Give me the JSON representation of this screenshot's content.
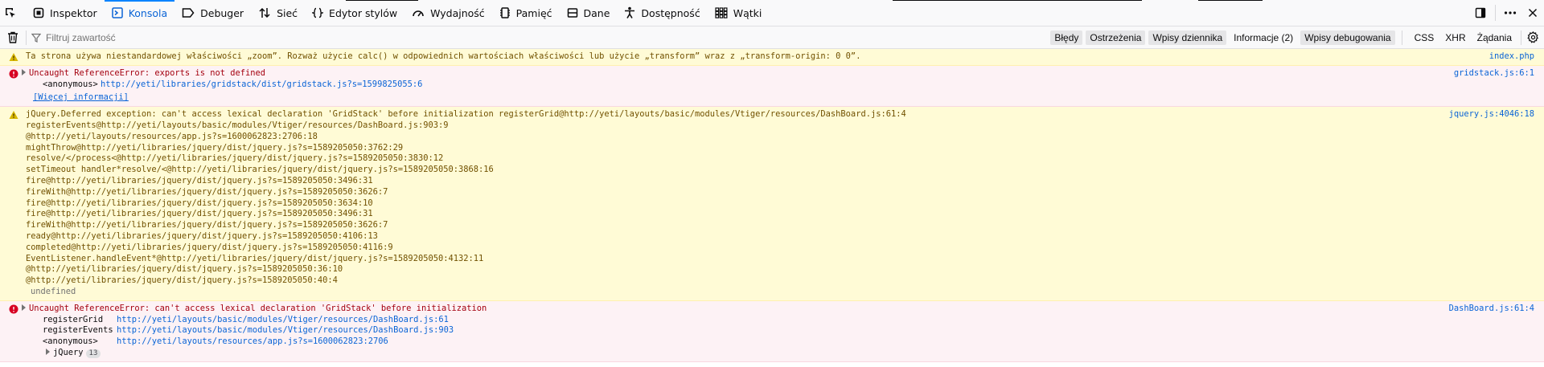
{
  "toolbar": {
    "tabs": [
      {
        "label": "Inspektor",
        "icon": "inspector-icon"
      },
      {
        "label": "Konsola",
        "icon": "console-icon",
        "selected": true
      },
      {
        "label": "Debuger",
        "icon": "debugger-icon"
      },
      {
        "label": "Sieć",
        "icon": "network-icon"
      },
      {
        "label": "Edytor stylów",
        "icon": "style-editor-icon"
      },
      {
        "label": "Wydajność",
        "icon": "performance-icon"
      },
      {
        "label": "Pamięć",
        "icon": "memory-icon"
      },
      {
        "label": "Dane",
        "icon": "storage-icon"
      },
      {
        "label": "Dostępność",
        "icon": "accessibility-icon"
      },
      {
        "label": "Wątki",
        "icon": "threads-icon"
      }
    ],
    "right_icons": [
      "dock-icon",
      "more-icon",
      "close-icon"
    ]
  },
  "filterbar": {
    "placeholder": "Filtruj zawartość",
    "levels": [
      {
        "label": "Błędy",
        "on": true
      },
      {
        "label": "Ostrzeżenia",
        "on": true
      },
      {
        "label": "Wpisy dziennika",
        "on": true
      },
      {
        "label": "Informacje (2)",
        "on": false
      },
      {
        "label": "Wpisy debugowania",
        "on": true
      }
    ],
    "extras": [
      "CSS",
      "XHR",
      "Żądania"
    ]
  },
  "messages": {
    "m1": {
      "text": "Ta strona używa niestandardowej właściwości „zoom”. Rozważ użycie calc() w odpowiednich wartościach właściwości lub użycie „transform” wraz z „transform-origin: 0 0”.",
      "location": "index.php"
    },
    "m2": {
      "text": "Uncaught ReferenceError: exports is not defined",
      "location": "gridstack.js:6:1",
      "frame_fn": "<anonymous>",
      "frame_url": "http://yeti/libraries/gridstack/dist/gridstack.js?s=1599825055:6",
      "more": "[Więcej informacji]"
    },
    "m3": {
      "location": "jquery.js:4046:18",
      "lines": [
        "jQuery.Deferred exception: can't access lexical declaration 'GridStack' before initialization registerGrid@http://yeti/layouts/basic/modules/Vtiger/resources/DashBoard.js:61:4",
        "registerEvents@http://yeti/layouts/basic/modules/Vtiger/resources/DashBoard.js:903:9",
        "@http://yeti/layouts/resources/app.js?s=1600062823:2706:18",
        "mightThrow@http://yeti/libraries/jquery/dist/jquery.js?s=1589205050:3762:29",
        "resolve/</process<@http://yeti/libraries/jquery/dist/jquery.js?s=1589205050:3830:12",
        "setTimeout handler*resolve/<@http://yeti/libraries/jquery/dist/jquery.js?s=1589205050:3868:16",
        "fire@http://yeti/libraries/jquery/dist/jquery.js?s=1589205050:3496:31",
        "fireWith@http://yeti/libraries/jquery/dist/jquery.js?s=1589205050:3626:7",
        "fire@http://yeti/libraries/jquery/dist/jquery.js?s=1589205050:3634:10",
        "fire@http://yeti/libraries/jquery/dist/jquery.js?s=1589205050:3496:31",
        "fireWith@http://yeti/libraries/jquery/dist/jquery.js?s=1589205050:3626:7",
        "ready@http://yeti/libraries/jquery/dist/jquery.js?s=1589205050:4106:13",
        "completed@http://yeti/libraries/jquery/dist/jquery.js?s=1589205050:4116:9",
        "EventListener.handleEvent*@http://yeti/libraries/jquery/dist/jquery.js?s=1589205050:4132:11",
        "@http://yeti/libraries/jquery/dist/jquery.js?s=1589205050:36:10",
        "@http://yeti/libraries/jquery/dist/jquery.js?s=1589205050:40:4"
      ],
      "tail": "undefined"
    },
    "m4": {
      "text": "Uncaught ReferenceError: can't access lexical declaration 'GridStack' before initialization",
      "location": "DashBoard.js:61:4",
      "frames": [
        {
          "fn": "registerGrid",
          "url": "http://yeti/layouts/basic/modules/Vtiger/resources/DashBoard.js:61"
        },
        {
          "fn": "registerEvents",
          "url": "http://yeti/layouts/basic/modules/Vtiger/resources/DashBoard.js:903"
        },
        {
          "fn": "<anonymous>",
          "url": "http://yeti/layouts/resources/app.js?s=1600062823:2706"
        }
      ],
      "group_label": "jQuery",
      "group_count": "13"
    }
  },
  "colors": {
    "accent": "#0a84ff",
    "warning_bg": "#fffbd6",
    "error_bg": "#fdf2f5",
    "warning_text": "#715100",
    "error_text": "#a4000f",
    "link": "#0a64d6"
  }
}
